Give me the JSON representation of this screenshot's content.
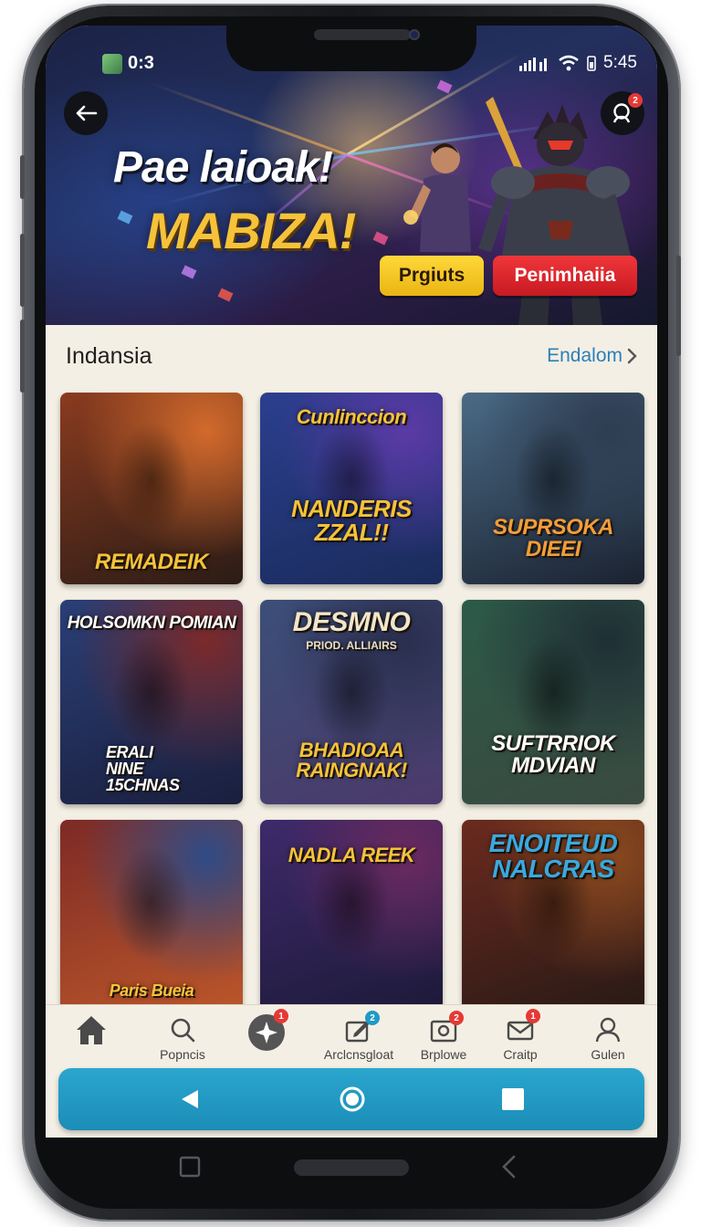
{
  "status_bar": {
    "left_time": "0:3",
    "right_time": "5:45"
  },
  "hero": {
    "title_line1": "Pae laioak!",
    "title_line2": "MABIZA!",
    "back_icon": "arrow-left-icon",
    "search_icon": "search-icon",
    "search_badge": "2",
    "button_primary": "Prgiuts",
    "button_secondary": "Penimhaiia",
    "accent_yellow": "#f5c23a",
    "accent_red": "#d92228"
  },
  "section": {
    "title": "Indansia",
    "see_all": "Endalom"
  },
  "games": [
    {
      "top": "",
      "bottom": "REMADEIK",
      "sub": "",
      "colors": [
        "#8a3b1f",
        "#d26a2c",
        "#2b1c16"
      ],
      "text_color": "#f5c23a"
    },
    {
      "top": "Cunlinccion",
      "bottom": "NANDERIS ZZAL!!",
      "sub": "",
      "colors": [
        "#2b3f8f",
        "#5b3aa6",
        "#1a2b5a"
      ],
      "text_color": "#f5c23a"
    },
    {
      "top": "",
      "bottom": "SUPRSOKA DIEEI",
      "sub": "",
      "colors": [
        "#4a6b86",
        "#2e3d52",
        "#1b2230"
      ],
      "text_color": "#f29d3a"
    },
    {
      "top": "HOLSOMKN POMIAN",
      "bottom": "ERALI NINE 15CHNAS",
      "sub": "",
      "colors": [
        "#2a3f77",
        "#7b2a2a",
        "#1a1f3d"
      ],
      "text_color": "#ffffff"
    },
    {
      "top": "DESMNO",
      "bottom": "BHADIOAA RAINGNAK!",
      "sub": "PRIOD. ALLIAIRS",
      "colors": [
        "#3b4f78",
        "#2a2f4e",
        "#4b3a6b"
      ],
      "text_color": "#f5c23a"
    },
    {
      "top": "",
      "bottom": "SUFTRRIOK MDVIAN",
      "sub": "",
      "colors": [
        "#2c5a48",
        "#1f2f35",
        "#3a4a40"
      ],
      "text_color": "#ffffff"
    },
    {
      "top": "",
      "bottom": "Paris Bueia",
      "sub": "",
      "colors": [
        "#7d2a26",
        "#2f4b86",
        "#b9552a"
      ],
      "text_color": "#f5c23a"
    },
    {
      "top": "NADLA REEK",
      "bottom": "",
      "sub": "",
      "colors": [
        "#3d2a6b",
        "#6b2a5f",
        "#1e1a3a"
      ],
      "text_color": "#f5c23a"
    },
    {
      "top": "ENOITEUD NALCRAS",
      "bottom": "",
      "sub": "",
      "colors": [
        "#6b2a1f",
        "#8a4a1f",
        "#2a1a16"
      ],
      "text_color": "#39a9e0"
    }
  ],
  "bottom_nav": [
    {
      "label": "",
      "icon": "home-icon",
      "badge": ""
    },
    {
      "label": "Popncis",
      "icon": "search-icon",
      "badge": ""
    },
    {
      "label": "",
      "icon": "compass-icon",
      "badge": "1"
    },
    {
      "label": "Arclcnsgloat",
      "icon": "edit-icon",
      "badge": "2"
    },
    {
      "label": "Brplowe",
      "icon": "photo-icon",
      "badge": "2"
    },
    {
      "label": "Craitp",
      "icon": "mail-icon",
      "badge": "1"
    },
    {
      "label": "Gulen",
      "icon": "user-icon",
      "badge": ""
    }
  ],
  "system_nav": {
    "back": "back-triangle-icon",
    "home": "home-circle-icon",
    "recents": "recents-square-icon",
    "color": "#1f9ac6"
  }
}
